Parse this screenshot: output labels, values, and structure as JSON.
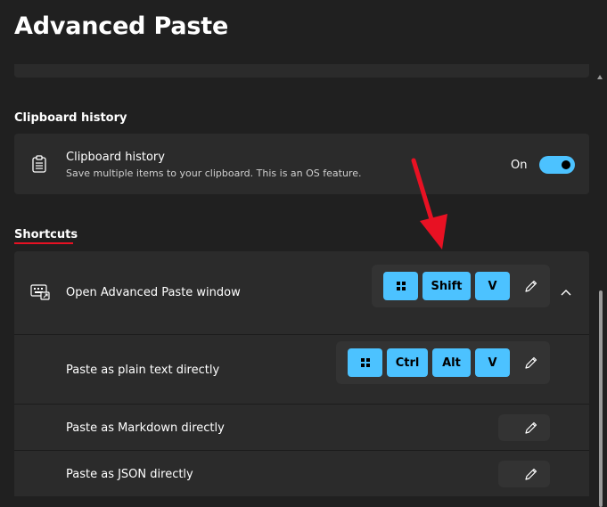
{
  "page": {
    "title": "Advanced Paste"
  },
  "clipboard_section": {
    "heading": "Clipboard history",
    "item": {
      "label": "Clipboard history",
      "description": "Save multiple items to your clipboard. This is an OS feature.",
      "toggle_state": "On",
      "toggle_on": true
    }
  },
  "shortcuts_section": {
    "heading": "Shortcuts",
    "rows": [
      {
        "label": "Open Advanced Paste window",
        "keys": [
          "win",
          "Shift",
          "V"
        ]
      },
      {
        "label": "Paste as plain text directly",
        "keys": [
          "win",
          "Ctrl",
          "Alt",
          "V"
        ]
      },
      {
        "label": "Paste as Markdown directly",
        "keys": []
      },
      {
        "label": "Paste as JSON directly",
        "keys": []
      }
    ]
  },
  "icons": {
    "clipboard": "clipboard-icon",
    "keyboard": "keyboard-shortcut-icon",
    "edit": "pencil-icon",
    "collapse": "chevron-up-icon",
    "win_key": "windows-logo-icon"
  },
  "colors": {
    "accent": "#4cc2ff",
    "background": "#202020",
    "card": "#2b2b2b",
    "annotation_arrow": "#e81123",
    "section_underline": "#e81123"
  }
}
